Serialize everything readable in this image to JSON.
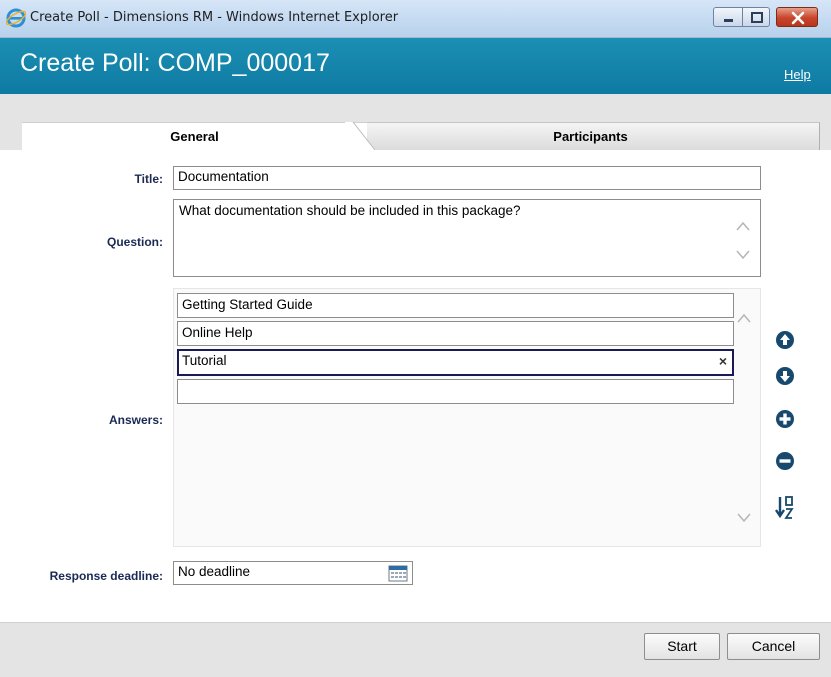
{
  "window": {
    "title": "Create Poll - Dimensions RM - Windows Internet Explorer"
  },
  "header": {
    "title": "Create Poll: COMP_000017",
    "help_label": "Help"
  },
  "tabs": [
    {
      "label": "General",
      "active": true
    },
    {
      "label": "Participants",
      "active": false
    }
  ],
  "form": {
    "title_label": "Title:",
    "title_value": "Documentation",
    "question_label": "Question:",
    "question_value": "What documentation should be included in this package?",
    "answers_label": "Answers:",
    "answers": [
      "Getting Started Guide",
      "Online Help",
      "Tutorial",
      ""
    ],
    "active_answer_clear": "×",
    "deadline_label": "Response deadline:",
    "deadline_value": "No deadline"
  },
  "answer_actions": [
    "move-up-icon",
    "move-down-icon",
    "add-icon",
    "remove-icon",
    "sort-az-icon"
  ],
  "footer": {
    "start_label": "Start",
    "cancel_label": "Cancel"
  },
  "colors": {
    "header": "#1484ab",
    "label": "#1a2a55",
    "action_icon": "#16496d"
  }
}
